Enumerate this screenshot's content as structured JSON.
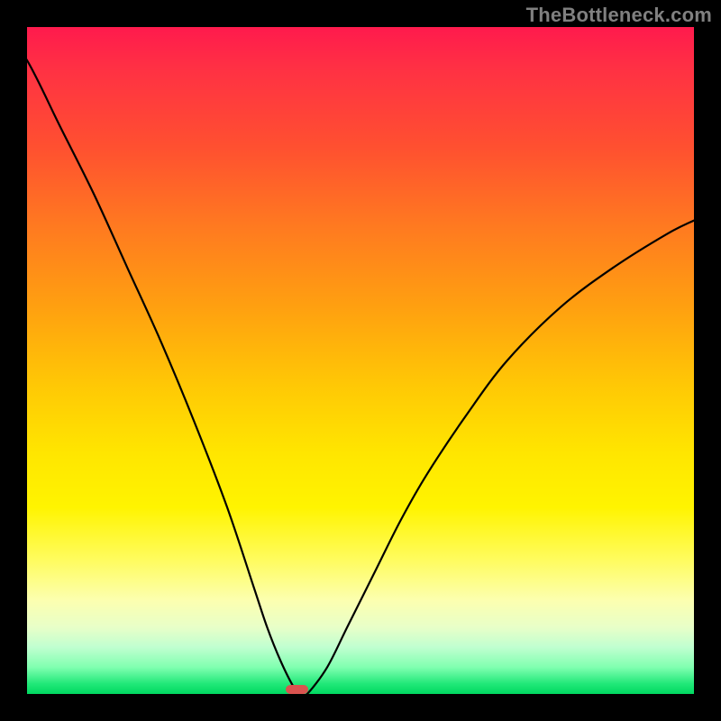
{
  "watermark": "TheBottleneck.com",
  "colors": {
    "frame": "#000000",
    "curve": "#000000",
    "marker": "#d9534f",
    "watermark_text": "#808080",
    "gradient_top": "#ff1a4d",
    "gradient_bottom": "#00d860"
  },
  "chart_data": {
    "type": "line",
    "title": "",
    "xlabel": "",
    "ylabel": "",
    "xlim": [
      0,
      100
    ],
    "ylim": [
      0,
      100
    ],
    "grid": false,
    "legend": false,
    "annotations": [],
    "x": [
      -4,
      0,
      5,
      10,
      15,
      20,
      25,
      30,
      34,
      36,
      38,
      40,
      41,
      42,
      45,
      48,
      52,
      56,
      60,
      66,
      72,
      80,
      88,
      96,
      100
    ],
    "values": [
      100,
      95,
      85,
      75,
      64,
      53,
      41,
      28,
      16,
      10,
      5,
      1,
      0,
      0,
      4,
      10,
      18,
      26,
      33,
      42,
      50,
      58,
      64,
      69,
      71
    ],
    "marker": {
      "x": 40.5,
      "y": 0,
      "width_pct": 3.4,
      "height_pct": 1.35
    },
    "background": "vertical-gradient red→yellow→green"
  }
}
